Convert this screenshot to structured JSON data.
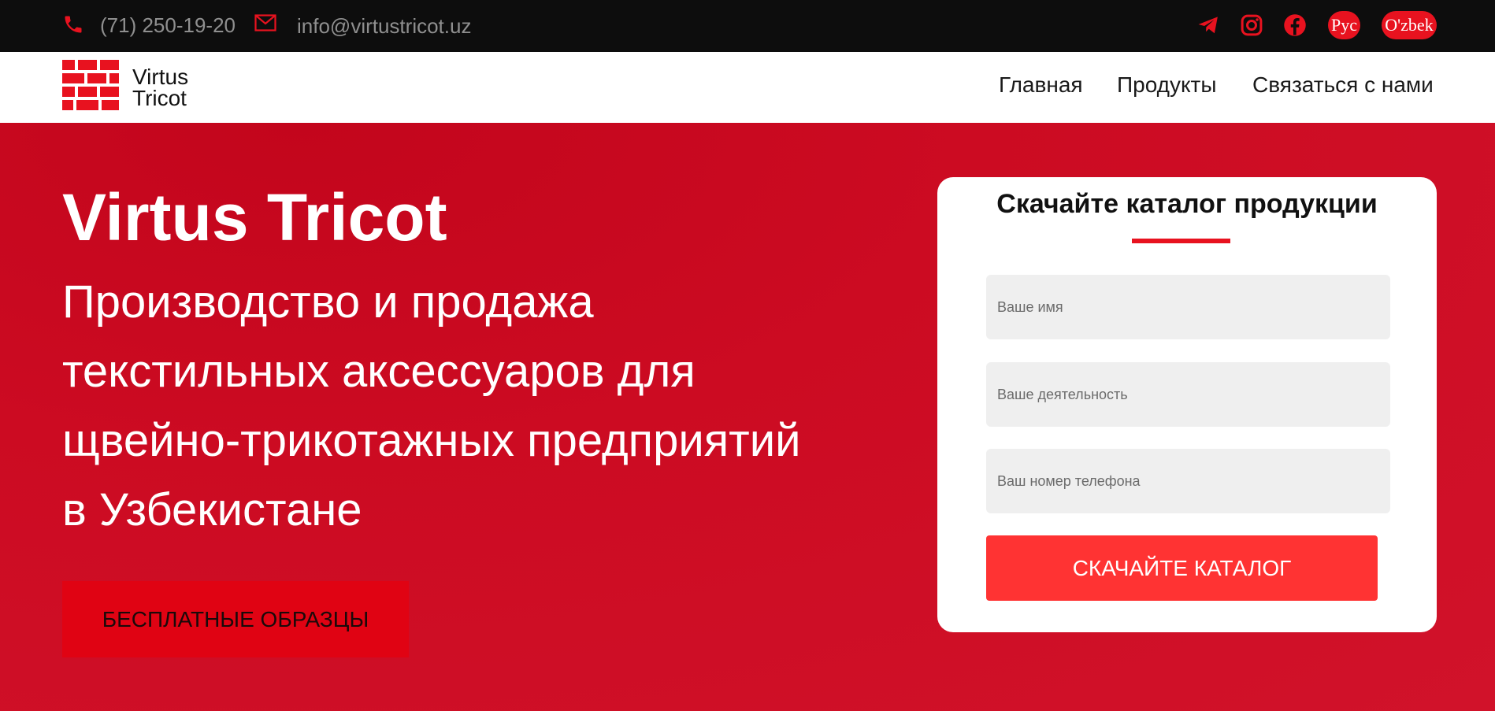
{
  "topbar": {
    "phone": "(71) 250-19-20",
    "email": "info@virtustricot.uz",
    "social": [
      {
        "icon": "telegram-icon"
      },
      {
        "icon": "instagram-icon"
      },
      {
        "icon": "facebook-icon"
      }
    ],
    "languages": [
      "Рус",
      "O'zbek"
    ]
  },
  "logo": {
    "line1": "Virtus",
    "line2": "Tricot"
  },
  "nav": {
    "items": [
      "Главная",
      "Продукты",
      "Связаться с нами"
    ]
  },
  "hero": {
    "title": "Virtus Tricot",
    "subtitle": "Производство и продажа текстильных аксессуаров для щвейно-трикотажных предприятий в Узбекистане",
    "cta_label": "БЕСПЛАТНЫЕ ОБРАЗЦЫ"
  },
  "form": {
    "title": "Скачайте каталог продукции",
    "name_placeholder": "Ваше имя",
    "activity_placeholder": "Ваше деятельность",
    "phone_placeholder": "Ваш номер телефона",
    "submit_label": "СКАЧАЙТЕ КАТАЛОГ"
  },
  "colors": {
    "accent": "#e8121f",
    "hero_bg": "#c8091f",
    "topbar_bg": "#0d0d0d",
    "submit_bg": "#ff3333"
  }
}
